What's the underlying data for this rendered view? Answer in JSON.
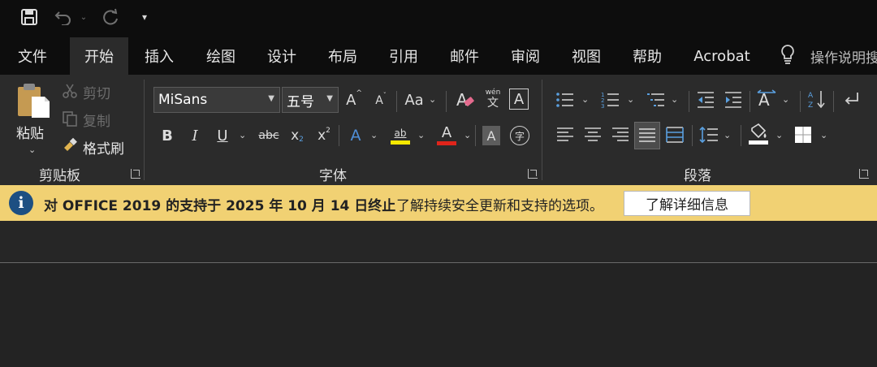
{
  "quick_access": {
    "save_icon": "save-icon",
    "undo_icon": "undo-icon",
    "redo_icon": "redo-icon",
    "customize_icon": "customize-qat-icon"
  },
  "tabs": [
    {
      "label": "文件",
      "active": false
    },
    {
      "label": "开始",
      "active": true
    },
    {
      "label": "插入",
      "active": false
    },
    {
      "label": "绘图",
      "active": false
    },
    {
      "label": "设计",
      "active": false
    },
    {
      "label": "布局",
      "active": false
    },
    {
      "label": "引用",
      "active": false
    },
    {
      "label": "邮件",
      "active": false
    },
    {
      "label": "审阅",
      "active": false
    },
    {
      "label": "视图",
      "active": false
    },
    {
      "label": "帮助",
      "active": false
    },
    {
      "label": "Acrobat",
      "active": false
    }
  ],
  "tell_me": {
    "icon": "lightbulb-icon",
    "label": "操作说明搜"
  },
  "clipboard": {
    "group_label": "剪贴板",
    "paste_label": "粘贴",
    "cut_label": "剪切",
    "copy_label": "复制",
    "format_painter_label": "格式刷"
  },
  "font": {
    "group_label": "字体",
    "font_name": "MiSans",
    "font_size": "五号",
    "change_case_label": "Aa",
    "phonetic_label": "wén",
    "phonetic_char": "文",
    "border_char": "A",
    "bold": "B",
    "italic": "I",
    "underline": "U",
    "strike": "abc",
    "subscript": "x",
    "superscript": "x",
    "highlight_text": "ab",
    "font_color_text": "A",
    "shading_char": "A",
    "enclose_char": "字",
    "grow_char": "A",
    "shrink_char": "A"
  },
  "paragraph": {
    "group_label": "段落"
  },
  "colors": {
    "highlight": "#f5e800",
    "font_color": "#e0241b",
    "infobar_bg": "#f1d173",
    "info_icon": "#1d4f82"
  },
  "infobar": {
    "bold_text": "对 OFFICE 2019 的支持于 2025 年 10 月 14 日终止",
    "text": "了解持续安全更新和支持的选项。",
    "button": "了解详细信息"
  }
}
